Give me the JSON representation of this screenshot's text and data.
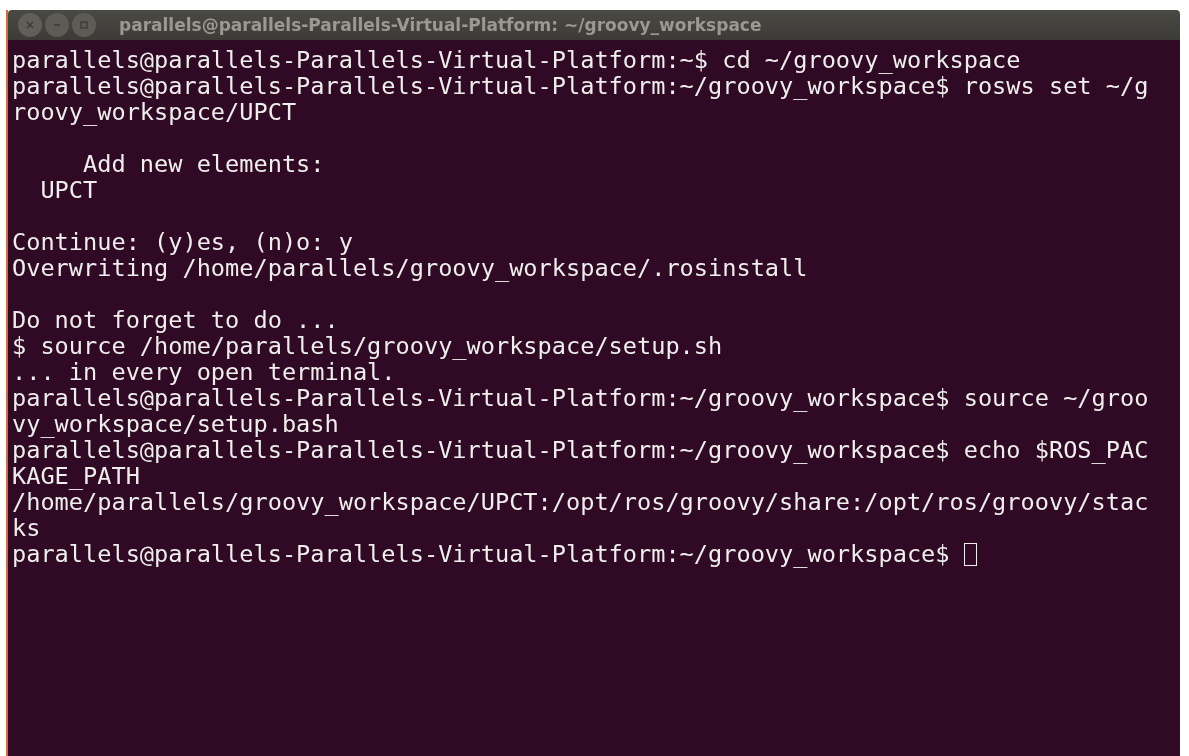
{
  "window": {
    "title": "parallels@parallels-Parallels-Virtual-Platform: ~/groovy_workspace"
  },
  "terminal": {
    "blocks": [
      [
        "parallels@parallels-Parallels-Virtual-Platform:~$ cd ~/groovy_workspace",
        "parallels@parallels-Parallels-Virtual-Platform:~/groovy_workspace$ rosws set ~/g",
        "roovy_workspace/UPCT"
      ],
      [
        "     Add new elements:",
        "  UPCT"
      ],
      [
        "Continue: (y)es, (n)o: y",
        "Overwriting /home/parallels/groovy_workspace/.rosinstall"
      ],
      [
        "Do not forget to do ...",
        "$ source /home/parallels/groovy_workspace/setup.sh",
        "... in every open terminal.",
        "parallels@parallels-Parallels-Virtual-Platform:~/groovy_workspace$ source ~/groo",
        "vy_workspace/setup.bash",
        "parallels@parallels-Parallels-Virtual-Platform:~/groovy_workspace$ echo $ROS_PAC",
        "KAGE_PATH",
        "/home/parallels/groovy_workspace/UPCT:/opt/ros/groovy/share:/opt/ros/groovy/stac",
        "ks",
        "parallels@parallels-Parallels-Virtual-Platform:~/groovy_workspace$ "
      ]
    ]
  }
}
